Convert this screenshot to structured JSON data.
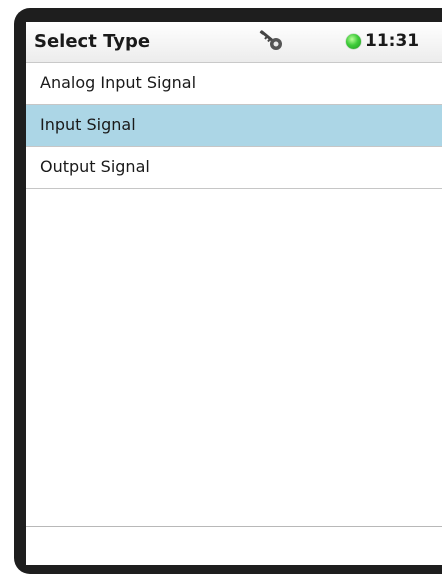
{
  "header": {
    "title": "Select Type",
    "icon": "key-icon",
    "status_icon": "status-led-icon",
    "status_color": "#3fcc3a",
    "time": "11:31"
  },
  "list": {
    "items": [
      {
        "label": "Analog Input Signal",
        "selected": false
      },
      {
        "label": "Input Signal",
        "selected": true
      },
      {
        "label": "Output Signal",
        "selected": false
      }
    ],
    "selected_color": "#acd6e6"
  },
  "footer": {
    "text": ""
  }
}
